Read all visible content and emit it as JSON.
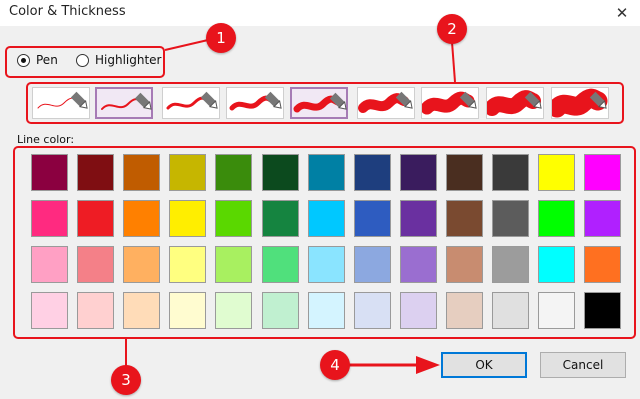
{
  "window": {
    "title": "Color & Thickness",
    "close_glyph": "✕"
  },
  "mode": {
    "pen_label": "Pen",
    "highlighter_label": "Highlighter",
    "selected": "pen"
  },
  "thickness": {
    "count": 9,
    "selected_indices": [
      1,
      4
    ]
  },
  "line_color_label": "Line color:",
  "palette": [
    [
      "#8b0040",
      "#7f0e12",
      "#c05c00",
      "#c6b600",
      "#3a8c0c",
      "#0c4a1e",
      "#0080a4",
      "#1e3e7e",
      "#3a1c5e",
      "#4a2e20",
      "#3a3a3a",
      "#ffff00",
      "#ff00ff"
    ],
    [
      "#ff2a80",
      "#ee1c24",
      "#ff8000",
      "#ffee00",
      "#5ad800",
      "#158440",
      "#00c8ff",
      "#2e5cc0",
      "#6a30a0",
      "#7a4a30",
      "#5c5c5c",
      "#00ff00",
      "#b020ff"
    ],
    [
      "#ffa0c4",
      "#f48088",
      "#ffb060",
      "#ffff80",
      "#a8f060",
      "#50e07c",
      "#8ae4ff",
      "#8ca8e0",
      "#9a6ed0",
      "#c88c70",
      "#9c9c9c",
      "#00ffff",
      "#ff7020"
    ],
    [
      "#ffd0e4",
      "#ffd0d0",
      "#ffdcb8",
      "#fffcd0",
      "#e0fcd0",
      "#c0f0d0",
      "#d4f4ff",
      "#d8e0f4",
      "#dcd0f0",
      "#e6cec0",
      "#e0e0e0",
      "#f4f4f4",
      "#000000"
    ]
  ],
  "buttons": {
    "ok_label": "OK",
    "cancel_label": "Cancel"
  },
  "callouts": [
    "1",
    "2",
    "3",
    "4"
  ],
  "colors": {
    "callout_red": "#e8141c",
    "selection_purple": "#a67bb5"
  }
}
